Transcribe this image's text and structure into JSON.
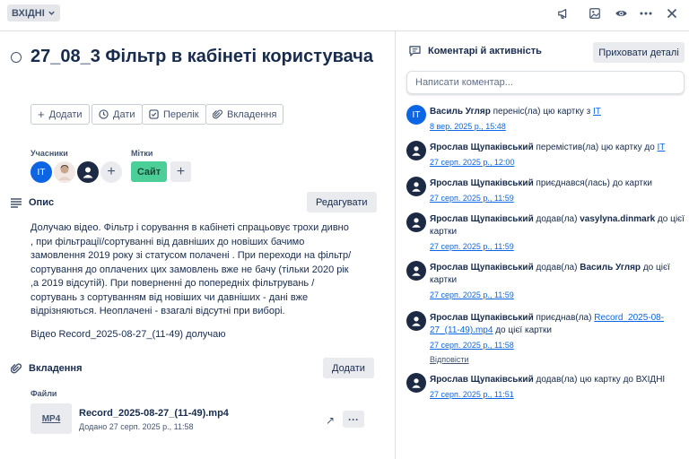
{
  "header": {
    "list_name": "ВХІДНІ",
    "icons": [
      "megaphone-icon",
      "image-icon",
      "eye-icon",
      "more-icon",
      "close-icon"
    ]
  },
  "card": {
    "title": "27_08_3 Фільтр в кабінеті користувача"
  },
  "actions": {
    "add": "Додати",
    "dates": "Дати",
    "checklist": "Перелік",
    "attachment": "Вкладення"
  },
  "members": {
    "label": "Учасники",
    "initials": "IT"
  },
  "labels": {
    "label": "Мітки",
    "chip": "Сайт"
  },
  "description": {
    "heading": "Опис",
    "edit_button": "Редагувати",
    "p1": "Долучаю відео. Фільтр і сорування в кабінеті спрацьовує трохи дивно , при фільтрації/сортуванні від давніших до новіших бачимо замовлення 2019 року зі статусом полачені . При переходи на фільтр/сортування до  оплачених цих замовлень вже не бачу (тільки 2020 рік ,а  2019 відсутій). При поверненні до попередніх фільтрувань /сортувань з сортуванням від новіших чи давніших  - дані вже відрізняються. Неоплачені - взагалі відсутні при виборі.",
    "p2": "Відео Record_2025-08-27_(11-49) долучаю"
  },
  "attachments": {
    "heading": "Вкладення",
    "add_button": "Додати",
    "files_label": "Файли",
    "file_type": "MP4",
    "file_name": "Record_2025-08-27_(11-49).mp4",
    "file_meta": "Додано 27 серп. 2025 р., 11:58"
  },
  "activity_panel": {
    "heading": "Коментарі й активність",
    "hide_button": "Приховати деталі",
    "comment_placeholder": "Написати коментар...",
    "items": [
      {
        "user": "Василь Угляр",
        "pre": " переніс(ла) цю картку з ",
        "link": "IT",
        "post": "",
        "time": "8 вер. 2025 р., 15:48"
      },
      {
        "user": "Ярослав Щупаківський",
        "pre": " перемістив(ла) цю картку до ",
        "link": "IT",
        "post": "",
        "time": "27 серп. 2025 р., 12:00"
      },
      {
        "user": "Ярослав Щупаківський",
        "pre": " приєднався(лась) до картки",
        "link": "",
        "post": "",
        "time": "27 серп. 2025 р., 11:59"
      },
      {
        "user": "Ярослав Щупаківський",
        "pre": " додав(ла) ",
        "bold": "vasylyna.dinmark",
        "post": " до цієї картки",
        "time": "27 серп. 2025 р., 11:59"
      },
      {
        "user": "Ярослав Щупаківський",
        "pre": " додав(ла) ",
        "bold": "Василь Угляр",
        "post": " до цієї картки",
        "time": "27 серп. 2025 р., 11:59"
      },
      {
        "user": "Ярослав Щупаківський",
        "pre": " приєднав(ла) ",
        "link": "Record_2025-08-27_(11-49).mp4",
        "post": " до цієї картки",
        "time": "27 серп. 2025 р., 11:58",
        "reply": "Відповісти"
      },
      {
        "user": "Ярослав Щупаківський",
        "pre": " додав(ла) цю картку до ВХІДНІ",
        "link": "",
        "post": "",
        "time": "27 серп. 2025 р., 11:51"
      }
    ]
  },
  "colors": {
    "accent": "#0c66e4",
    "label_green": "#4bce97",
    "text": "#172b4d"
  }
}
